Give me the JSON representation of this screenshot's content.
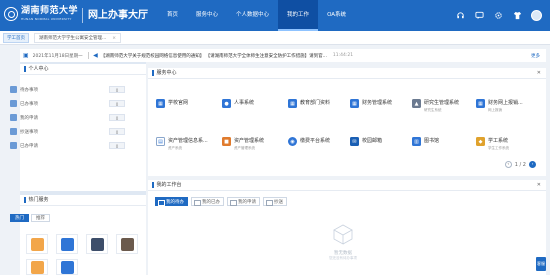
{
  "header": {
    "school_cn": "湖南师范大学",
    "school_en": "HUNAN NORMAL UNIVERSITY",
    "portal_title": "网上办事大厅",
    "nav": [
      "首页",
      "服务中心",
      "个人数据中心",
      "我的工作",
      "OA系统"
    ],
    "active_nav": "我的工作",
    "icons": [
      "headset-icon",
      "chat-icon",
      "settings-icon",
      "shirt-icon"
    ]
  },
  "tabs": {
    "home": "学工首页",
    "open": [
      "湖南师范大学学生公寓安全管理..."
    ],
    "close_glyph": "×"
  },
  "notice": {
    "date": "2021年11月18日星期一",
    "text": "【湖南师范大学关于规范校园网络信息使用的通知】 【请湖南师范大学全体师生注意安全防护工作措施】请到官...",
    "time": "11:44:21",
    "more": "更多"
  },
  "my_center": {
    "title": "个人中心",
    "rows": [
      {
        "label": "待办事项",
        "count": "0"
      },
      {
        "label": "已办事项",
        "count": "0"
      },
      {
        "label": "我的申请",
        "count": "0"
      },
      {
        "label": "抄送事项",
        "count": "0"
      },
      {
        "label": "已办申请",
        "count": "0"
      }
    ]
  },
  "popular": {
    "title": "热门服务",
    "tabs": [
      "热门",
      "推荐"
    ],
    "tiles": [
      "tile-1",
      "tile-2",
      "tile-3",
      "tile-4",
      "tile-5",
      "tile-6"
    ]
  },
  "service_center": {
    "title": "服务中心",
    "items": [
      {
        "name": "学校官网",
        "sub": "",
        "color": "#2f75d6",
        "icon": "windows-icon"
      },
      {
        "name": "人事系统",
        "sub": "",
        "color": "#2f75d6",
        "icon": "person-icon"
      },
      {
        "name": "教育部门资料",
        "sub": "",
        "color": "#2f75d6",
        "icon": "windows-icon"
      },
      {
        "name": "财务管理系统",
        "sub": "",
        "color": "#2f75d6",
        "icon": "windows-icon"
      },
      {
        "name": "研究生管理系统",
        "sub": "研究生系统",
        "color": "#6b7a90",
        "icon": "graduate-icon"
      },
      {
        "name": "财务网上报销...",
        "sub": "网上报销",
        "color": "#2f75d6",
        "icon": "windows-icon"
      },
      {
        "name": "资产管理信息系...",
        "sub": "资产系统",
        "color": "#ffffff",
        "icon": "document-icon"
      },
      {
        "name": "资产管理系统",
        "sub": "资产管理系统",
        "color": "#e07b2d",
        "icon": "box-icon"
      },
      {
        "name": "缴费平台系统",
        "sub": "",
        "color": "#2f75d6",
        "icon": "globe-icon"
      },
      {
        "name": "校园邮箱",
        "sub": "",
        "color": "#1a5fb4",
        "icon": "mail-icon"
      },
      {
        "name": "图书馆",
        "sub": "",
        "color": "#2f75d6",
        "icon": "book-icon"
      },
      {
        "name": "学工系统",
        "sub": "学生工作系统",
        "color": "#e0a22d",
        "icon": "student-icon"
      }
    ],
    "page": "1 / 2"
  },
  "my_work": {
    "title": "我的工作台",
    "tabs": [
      "我的待办",
      "我的已办",
      "我的申请",
      "抄送"
    ],
    "empty_title": "暂无数据",
    "empty_sub": "您还没有待办事项"
  },
  "float_button": "客服"
}
